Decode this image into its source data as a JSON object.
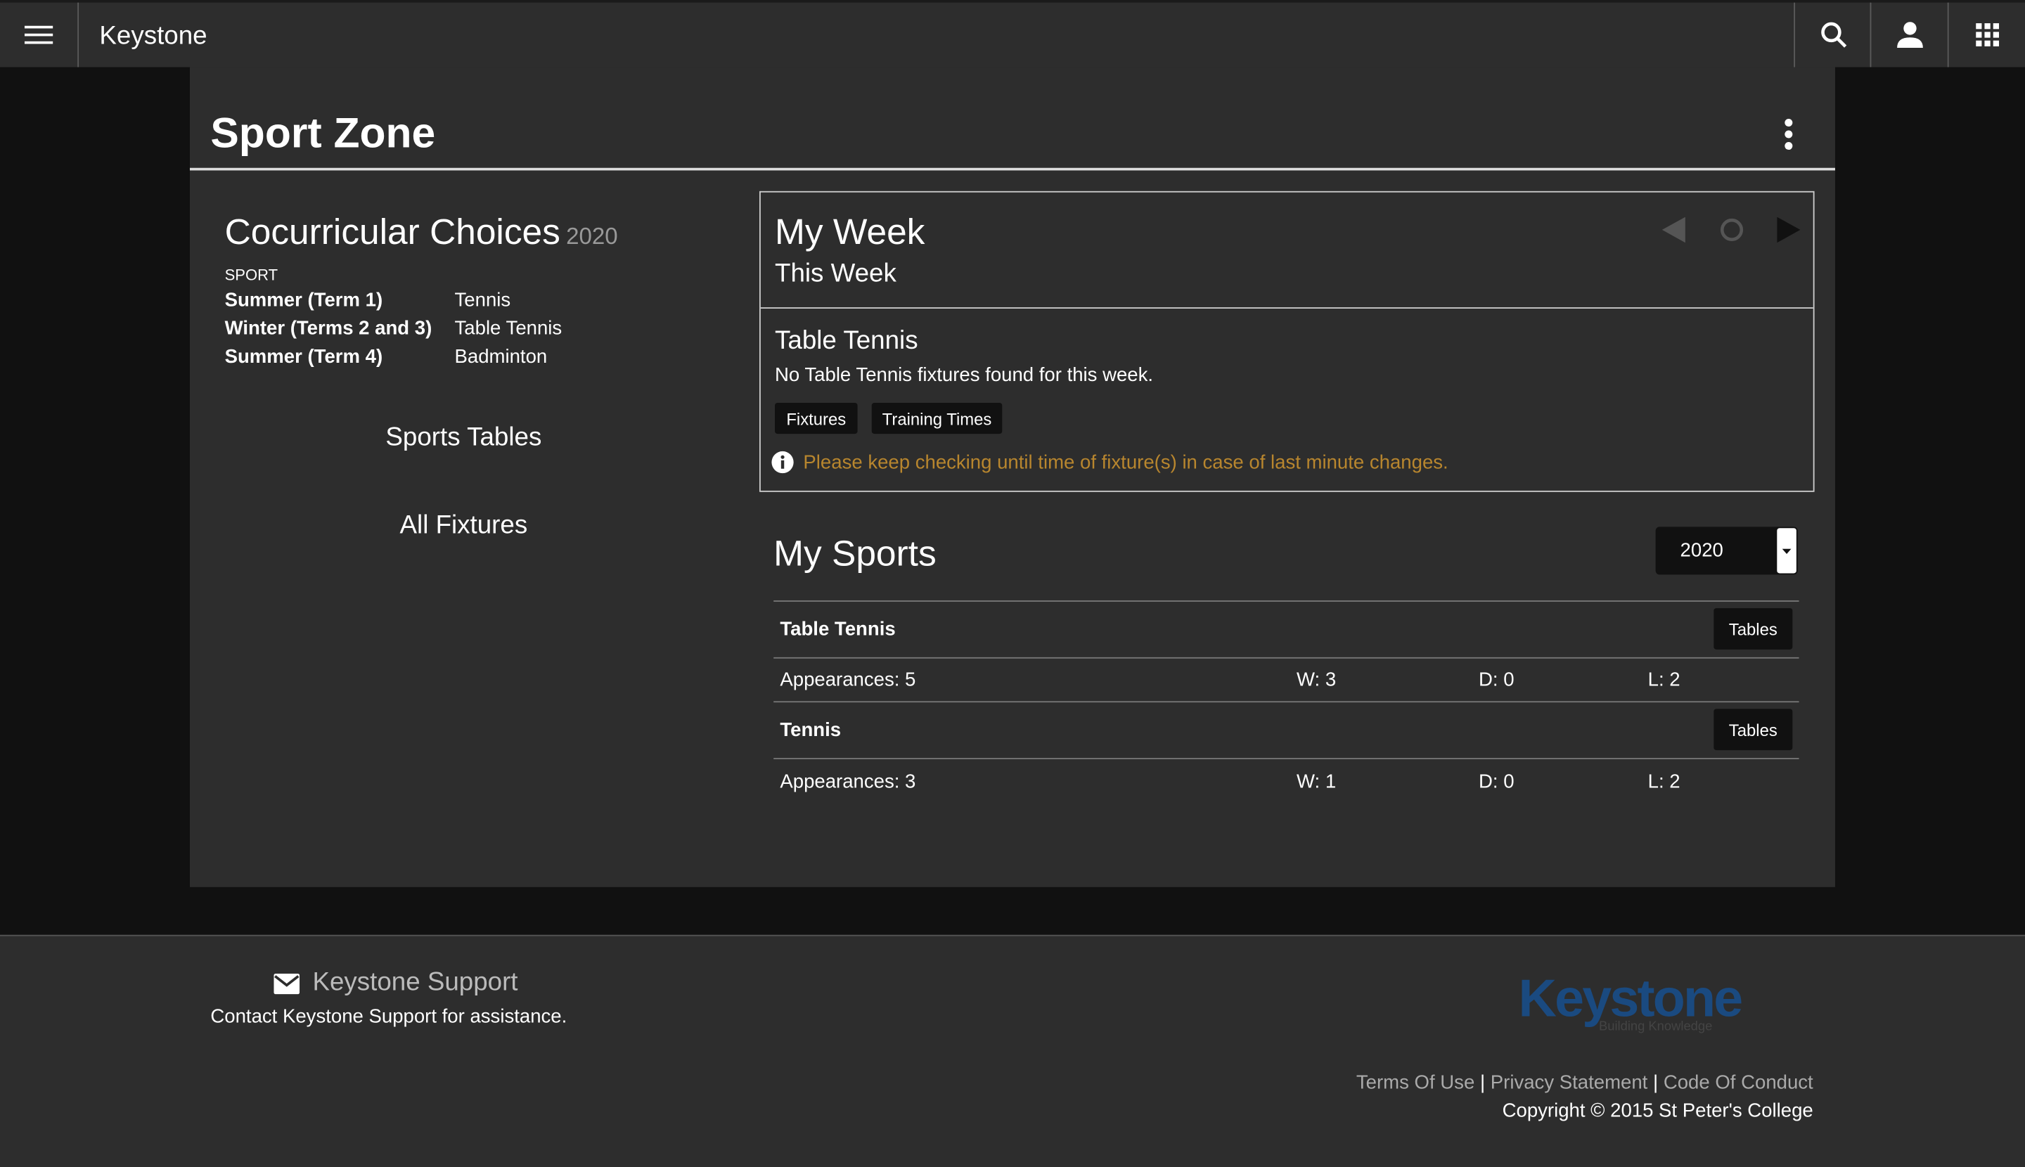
{
  "app": {
    "title": "Keystone"
  },
  "page": {
    "title": "Sport Zone"
  },
  "choices": {
    "title": "Cocurricular Choices",
    "year": "2020",
    "column_label": "SPORT",
    "rows": [
      {
        "term": "Summer (Term 1)",
        "sport": "Tennis"
      },
      {
        "term": "Winter (Terms 2 and 3)",
        "sport": "Table Tennis"
      },
      {
        "term": "Summer (Term 4)",
        "sport": "Badminton"
      }
    ]
  },
  "links": {
    "sports_tables": "Sports Tables",
    "all_fixtures": "All Fixtures"
  },
  "my_week": {
    "title": "My Week",
    "subtitle": "This Week",
    "sport": "Table Tennis",
    "message": "No Table Tennis fixtures found for this week.",
    "fixtures_btn": "Fixtures",
    "training_btn": "Training Times",
    "notice": "Please keep checking until time of fixture(s) in case of last minute changes.",
    "notice_color": "#b8862e"
  },
  "my_sports": {
    "title": "My Sports",
    "year_selected": "2020",
    "sports": [
      {
        "name": "Table Tennis",
        "tables_btn": "Tables",
        "appearances": "Appearances: 5",
        "w": "W: 3",
        "d": "D: 0",
        "l": "L: 2"
      },
      {
        "name": "Tennis",
        "tables_btn": "Tables",
        "appearances": "Appearances: 3",
        "w": "W: 1",
        "d": "D: 0",
        "l": "L: 2"
      }
    ]
  },
  "footer": {
    "support_title": "Keystone Support",
    "support_text": "Contact Keystone Support for assistance.",
    "logo": "Keystone",
    "logo_tagline": "Building Knowledge",
    "terms": "Terms Of Use",
    "privacy": "Privacy Statement",
    "conduct": "Code Of Conduct",
    "sep": "|",
    "copyright": "Copyright © 2015 St Peter's College",
    "logo_color": "#1a4a80"
  }
}
